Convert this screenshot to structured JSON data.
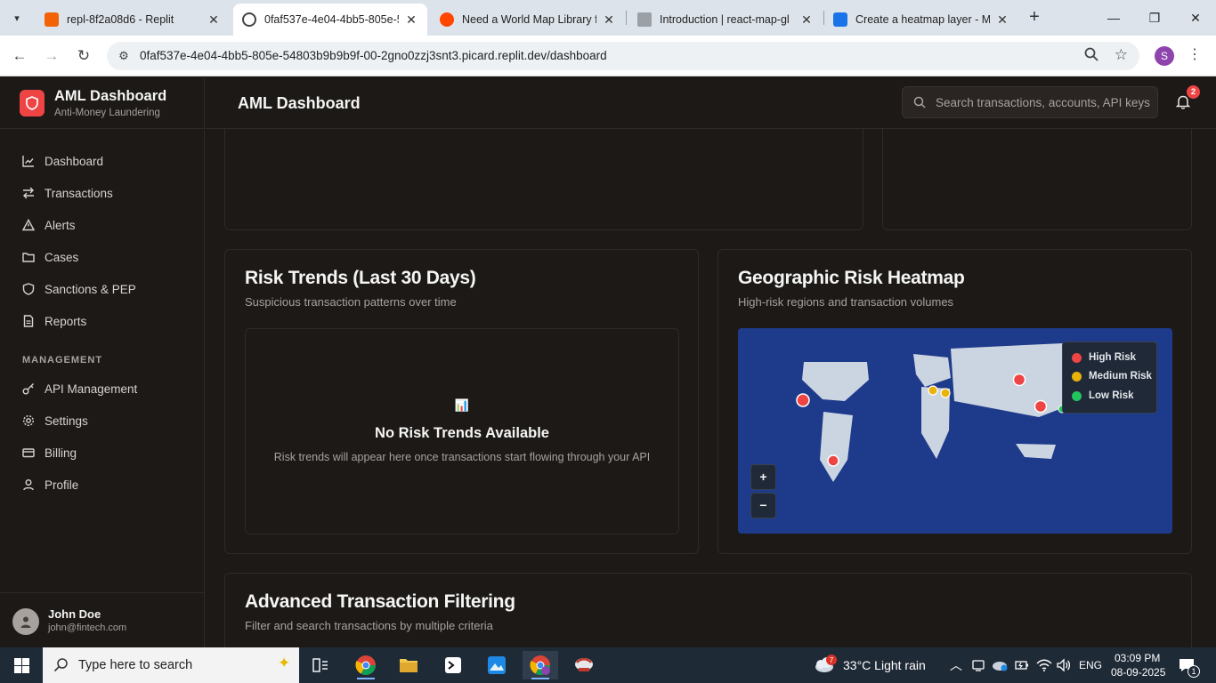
{
  "browser": {
    "tabs": [
      {
        "title": "repl-8f2a08d6 - Replit",
        "icon": "replit-icon"
      },
      {
        "title": "0faf537e-4e04-4bb5-805e-5",
        "icon": "globe-icon"
      },
      {
        "title": "Need a World Map Library fo",
        "icon": "reddit-icon"
      },
      {
        "title": "Introduction | react-map-gl",
        "icon": "vis-icon"
      },
      {
        "title": "Create a heatmap layer - Ma",
        "icon": "maps-icon"
      }
    ],
    "url": "0faf537e-4e04-4bb5-805e-54803b9b9b9f-00-2gno0zzj3snt3.picard.replit.dev/dashboard",
    "profile_initial": "S"
  },
  "sidebar": {
    "app_name": "AML Dashboard",
    "app_subtitle": "Anti-Money Laundering",
    "items": [
      {
        "label": "Dashboard",
        "icon": "chart-line-icon"
      },
      {
        "label": "Transactions",
        "icon": "arrows-exchange-icon"
      },
      {
        "label": "Alerts",
        "icon": "warning-triangle-icon"
      },
      {
        "label": "Cases",
        "icon": "folder-icon"
      },
      {
        "label": "Sanctions & PEP",
        "icon": "shield-icon"
      },
      {
        "label": "Reports",
        "icon": "file-text-icon"
      }
    ],
    "management_heading": "MANAGEMENT",
    "management_items": [
      {
        "label": "API Management",
        "icon": "key-icon"
      },
      {
        "label": "Settings",
        "icon": "gear-icon"
      },
      {
        "label": "Billing",
        "icon": "credit-card-icon"
      },
      {
        "label": "Profile",
        "icon": "user-icon"
      }
    ],
    "user": {
      "name": "John Doe",
      "email": "john@fintech.com"
    }
  },
  "header": {
    "title": "AML Dashboard",
    "search_placeholder": "Search transactions, accounts, API keys",
    "notification_count": "2"
  },
  "risk_trends": {
    "title": "Risk Trends (Last 30 Days)",
    "subtitle": "Suspicious transaction patterns over time",
    "empty_icon": "📊",
    "empty_title": "No Risk Trends Available",
    "empty_desc": "Risk trends will appear here once transactions start flowing through your API"
  },
  "heatmap": {
    "title": "Geographic Risk Heatmap",
    "subtitle": "High-risk regions and transaction volumes",
    "legend": [
      {
        "label": "High Risk",
        "color": "#ef4444"
      },
      {
        "label": "Medium Risk",
        "color": "#eab308"
      },
      {
        "label": "Low Risk",
        "color": "#22c55e"
      }
    ],
    "zoom_in": "+",
    "zoom_out": "−"
  },
  "filtering": {
    "title": "Advanced Transaction Filtering",
    "subtitle": "Filter and search transactions by multiple criteria"
  },
  "taskbar": {
    "search_placeholder": "Type here to search",
    "weather_badge": "7",
    "weather": "33°C  Light rain",
    "language": "ENG",
    "time": "03:09 PM",
    "date": "08-09-2025",
    "notif_count": "1"
  },
  "colors": {
    "accent": "#ef4444",
    "map_bg": "#1e3a8a",
    "land": "#cbd5e1"
  }
}
